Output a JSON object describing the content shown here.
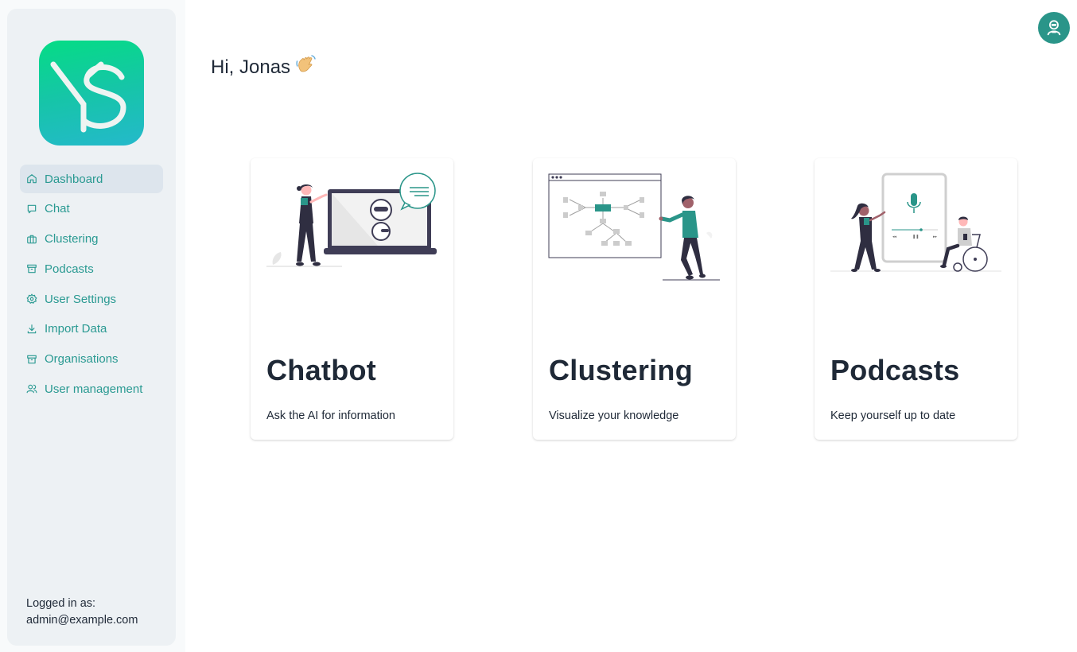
{
  "sidebar": {
    "items": [
      {
        "label": "Dashboard",
        "icon": "home-icon",
        "active": true
      },
      {
        "label": "Chat",
        "icon": "chat-bubble-icon"
      },
      {
        "label": "Clustering",
        "icon": "briefcase-icon"
      },
      {
        "label": "Podcasts",
        "icon": "archive-icon"
      },
      {
        "label": "User Settings",
        "icon": "gear-icon"
      },
      {
        "label": "Import Data",
        "icon": "download-icon"
      },
      {
        "label": "Organisations",
        "icon": "archive-icon"
      },
      {
        "label": "User management",
        "icon": "users-icon"
      }
    ],
    "footer": {
      "label": "Logged in as:",
      "email": "admin@example.com"
    }
  },
  "header": {
    "greeting": "Hi, Jonas",
    "greeting_emoji": "waving-hand",
    "avatar_icon": "user-avatar-icon"
  },
  "cards": [
    {
      "title": "Chatbot",
      "subtitle": "Ask the AI for information",
      "illustration": "chatbot-illustration"
    },
    {
      "title": "Clustering",
      "subtitle": "Visualize your knowledge",
      "illustration": "clustering-illustration"
    },
    {
      "title": "Podcasts",
      "subtitle": "Keep yourself up to date",
      "illustration": "podcasts-illustration"
    }
  ],
  "colors": {
    "accent": "#2a9a92",
    "sidebar_bg": "#edf1f4",
    "active_item_bg": "#dde5ed",
    "logo_gradient_top": "#05dc85",
    "logo_gradient_bottom": "#24b9cb",
    "text": "#1f2937"
  }
}
